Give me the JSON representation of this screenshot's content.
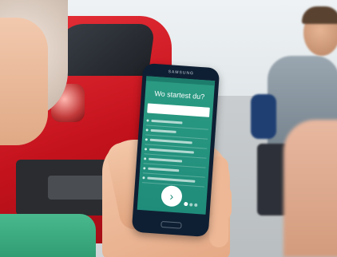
{
  "phone": {
    "brand": "SAMSUNG",
    "screen": {
      "title": "Wo startest du?",
      "search_placeholder": "",
      "list_items": [
        {
          "bar_fraction": 0.55
        },
        {
          "bar_fraction": 0.45
        },
        {
          "bar_fraction": 0.75
        },
        {
          "bar_fraction": 0.8
        },
        {
          "bar_fraction": 0.6
        },
        {
          "bar_fraction": 0.55
        },
        {
          "bar_fraction": 0.85
        }
      ],
      "next_icon": "chevron-right-icon",
      "pager_dots": 3,
      "active_dot": 0
    }
  },
  "colors": {
    "screen_bg": "#1f8c7a",
    "train": "#c4121c",
    "shirt": "#2f9a71"
  }
}
